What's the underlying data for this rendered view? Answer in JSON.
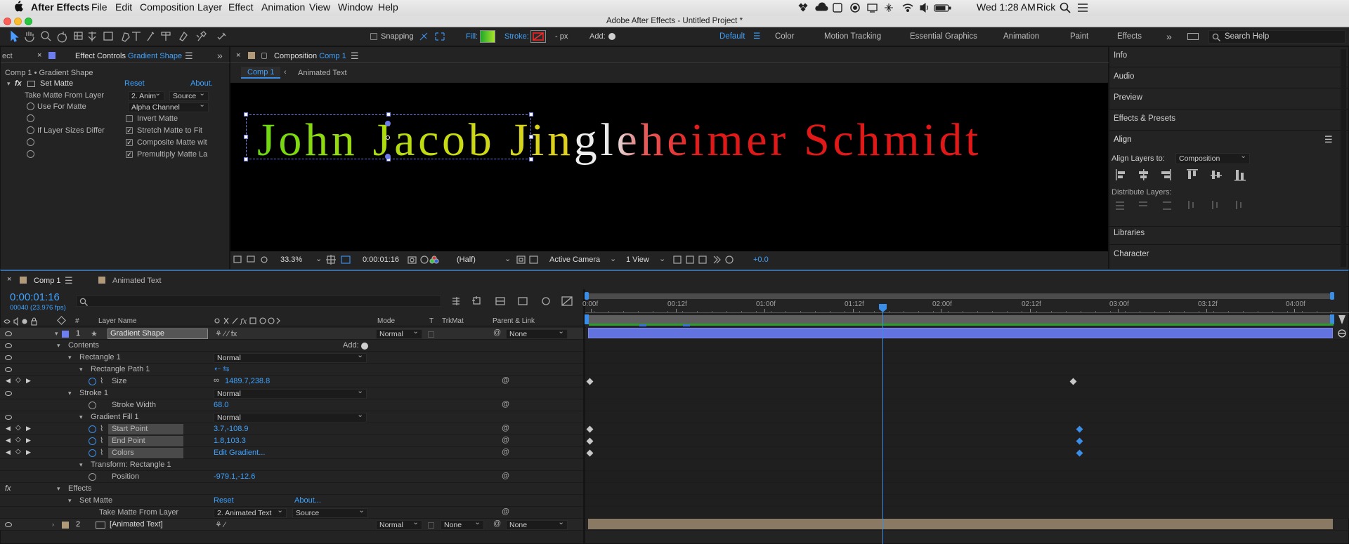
{
  "menubar": {
    "apple": "",
    "app": "After Effects",
    "items": [
      "File",
      "Edit",
      "Composition",
      "Layer",
      "Effect",
      "Animation",
      "View",
      "Window",
      "Help"
    ],
    "clock": "Wed 1:28 AM",
    "user": "Rick"
  },
  "window_title": "Adobe After Effects - Untitled Project *",
  "toolbar": {
    "snapping": "Snapping",
    "fill": "Fill:",
    "stroke": "Stroke:",
    "px": "- px",
    "add": "Add:",
    "workspaces": [
      "Default",
      "Color",
      "Motion Tracking",
      "Essential Graphics",
      "Animation",
      "Paint",
      "Effects"
    ],
    "search": "Search Help",
    "accent": "#3ea2ff"
  },
  "effect_controls": {
    "cut_tab": "ect",
    "tab": "Effect Controls",
    "tab_layer": "Gradient Shape",
    "header": "Comp 1 • Gradient Shape",
    "effect_name": "Set Matte",
    "reset": "Reset",
    "about": "About.",
    "take_matte_label": "Take Matte From Layer",
    "take_matte_value": "2. Anim",
    "source_value": "Source",
    "use_for_matte_label": "Use For Matte",
    "use_for_matte_value": "Alpha Channel",
    "invert_matte": "Invert Matte",
    "if_sizes_label": "If Layer Sizes Differ",
    "stretch": "Stretch Matte to Fit",
    "composite": "Composite Matte wit",
    "premultiply": "Premultiply Matte La"
  },
  "composition": {
    "tab": "Composition",
    "tab_comp": "Comp 1",
    "breadcrumbs": [
      "Comp 1",
      "Animated Text"
    ],
    "text_a": "John Jacob Jin",
    "text_b": "gle",
    "text_c": "heimer Schmidt",
    "zoom": "33.3%",
    "timecode": "0:00:01:16",
    "resolution": "(Half)",
    "camera": "Active Camera",
    "views": "1 View",
    "exposure": "+0.0"
  },
  "right_panel": {
    "items": [
      "Info",
      "Audio",
      "Preview",
      "Effects & Presets",
      "Align"
    ],
    "align_layers_to": "Align Layers to:",
    "align_value": "Composition",
    "distribute": "Distribute Layers:",
    "bottom_items": [
      "Libraries",
      "Character"
    ]
  },
  "timeline": {
    "tabs": [
      "Comp 1",
      "Animated Text"
    ],
    "timecode": "0:00:01:16",
    "frames": "00040 (23.976 fps)",
    "search_placeholder": "",
    "headers": {
      "hash": "#",
      "layer_name": "Layer Name",
      "mode": "Mode",
      "t": "T",
      "trkmat": "TrkMat",
      "parent": "Parent & Link"
    },
    "ruler": [
      "0:00f",
      "00:12f",
      "01:00f",
      "01:12f",
      "02:00f",
      "02:12f",
      "03:00f",
      "03:12f",
      "04:00f"
    ],
    "rows": [
      {
        "num": "1",
        "name": "Gradient Shape",
        "mode": "Normal",
        "parent": "None"
      },
      {
        "label": "Contents",
        "add": "Add:"
      },
      {
        "label": "Rectangle 1",
        "value": "Normal"
      },
      {
        "label": "Rectangle Path 1"
      },
      {
        "label": "Size",
        "value": "1489.7,238.8"
      },
      {
        "label": "Stroke 1",
        "value": "Normal"
      },
      {
        "label": "Stroke Width",
        "value": "68.0"
      },
      {
        "label": "Gradient Fill 1",
        "value": "Normal"
      },
      {
        "label": "Start Point",
        "value": "3.7,-108.9"
      },
      {
        "label": "End Point",
        "value": "1.8,103.3"
      },
      {
        "label": "Colors",
        "value": "Edit Gradient..."
      },
      {
        "label": "Transform: Rectangle 1"
      },
      {
        "label": "Position",
        "value": "-979.1,-12.6"
      },
      {
        "label": "Effects"
      },
      {
        "label": "Set Matte",
        "reset": "Reset",
        "about": "About..."
      },
      {
        "label": "Take Matte From Layer",
        "value": "2. Animated Text",
        "source": "Source"
      },
      {
        "num": "2",
        "name": "[Animated Text]",
        "mode": "Normal",
        "trkmat": "None",
        "parent": "None"
      }
    ]
  }
}
